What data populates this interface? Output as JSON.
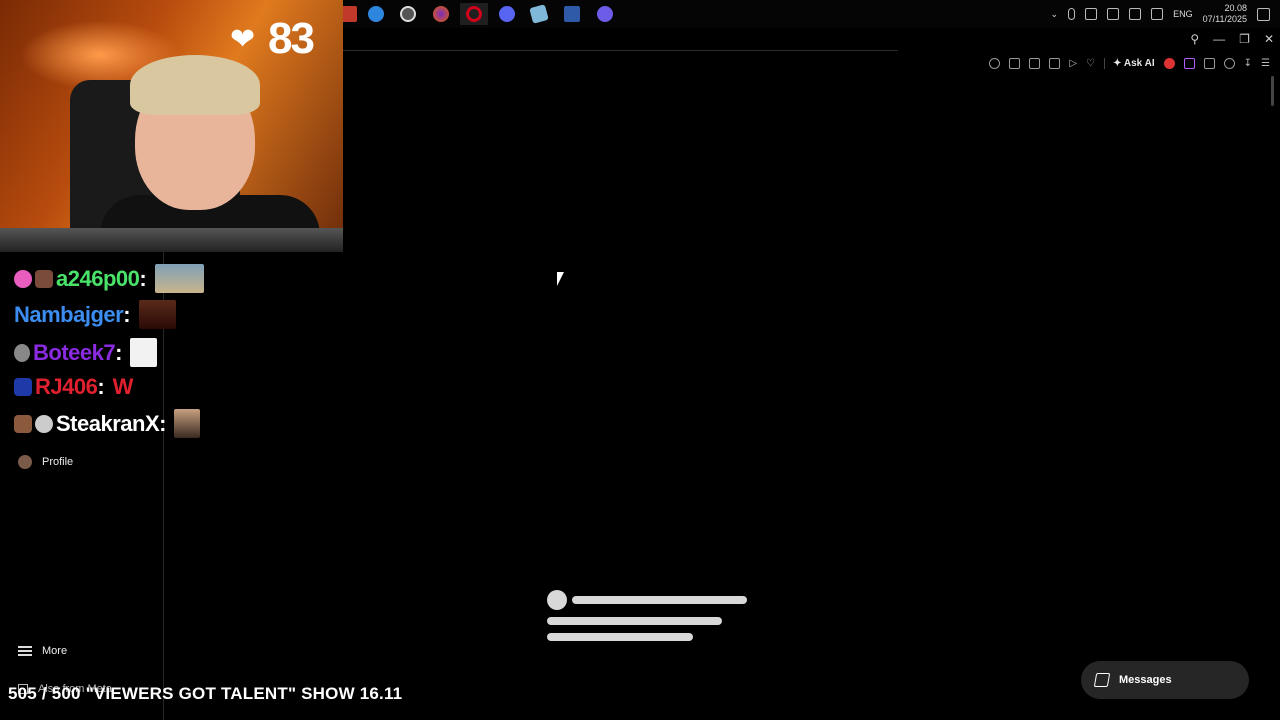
{
  "taskbar": {
    "apps": [
      {
        "icon": "app-icon",
        "color": "#c0392b"
      },
      {
        "icon": "ccleaner-icon",
        "color": "#2e86de"
      },
      {
        "icon": "obs-icon",
        "color": "#555555"
      },
      {
        "icon": "firefox-icon",
        "color": "#e66000"
      },
      {
        "icon": "opera-icon",
        "color": "#d0021b"
      },
      {
        "icon": "discord-icon",
        "color": "#5865f2"
      },
      {
        "icon": "notes-icon",
        "color": "#7fb8d8"
      },
      {
        "icon": "remote-desktop-icon",
        "color": "#2e5aa8"
      },
      {
        "icon": "keyboard-app-icon",
        "color": "#6c5ce7"
      }
    ],
    "tray": {
      "language": "ENG",
      "time": "20.08",
      "date": "07/11/2025"
    }
  },
  "toolbar": {
    "ask_ai_label": "Ask AI"
  },
  "stream_overlay": {
    "like_count": "83",
    "ticker_text": "505 / 500 \"VIEWERS GOT TALENT\" SHOW 16.11"
  },
  "chat": [
    {
      "username": "a246p00",
      "color": "#49e36a",
      "badges": [
        "#e85dbe",
        "#7a4a3a"
      ],
      "message_type": "emote"
    },
    {
      "username": "Nambajger",
      "color": "#3b8df0",
      "badges": [],
      "message_type": "emote"
    },
    {
      "username": "Boteek7",
      "color": "#8a2be2",
      "badges": [
        "#888888"
      ],
      "message_type": "emote"
    },
    {
      "username": "RJ406",
      "color": "#e0202e",
      "badges": [
        "#1e3aa8"
      ],
      "message": "W"
    },
    {
      "username": "SteakranX",
      "color": "#ffffff",
      "badges": [
        "#8b5a3c",
        "#cccccc"
      ],
      "message_type": "emote"
    }
  ],
  "sidebar": {
    "profile_label": "Profile",
    "more_label": "More",
    "also_from_meta_label": "Also from Meta"
  },
  "messages_button": {
    "label": "Messages"
  }
}
